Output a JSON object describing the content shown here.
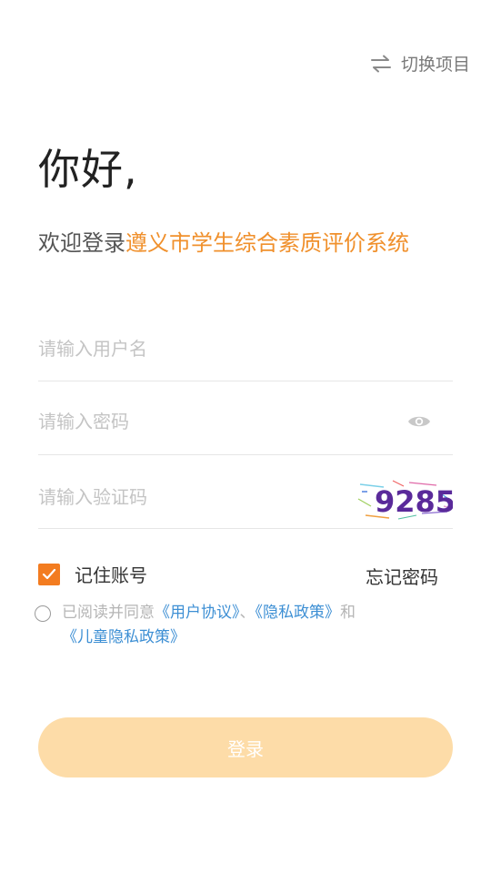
{
  "header": {
    "switch_label": "切换项目",
    "switch_icon": "swap-arrows-icon"
  },
  "greeting": "你好,",
  "welcome": {
    "prefix": "欢迎登录",
    "system_name": "遵义市学生综合素质评价系统"
  },
  "form": {
    "username_placeholder": "请输入用户名",
    "password_placeholder": "请输入密码",
    "captcha_placeholder": "请输入验证码",
    "captcha_text": "9285"
  },
  "remember": {
    "label": "记住账号",
    "checked": true
  },
  "forgot_label": "忘记密码",
  "agreement": {
    "prefix": "已阅读并同意",
    "link1": "《用户协议》",
    "sep": "、",
    "link2": "《隐私政策》",
    "and": "和",
    "link3": "《儿童隐私政策》"
  },
  "login_label": "登录",
  "colors": {
    "accent": "#f37c20",
    "system_name": "#f0902c",
    "link": "#3d8fd4",
    "button_bg": "#fddca8"
  }
}
